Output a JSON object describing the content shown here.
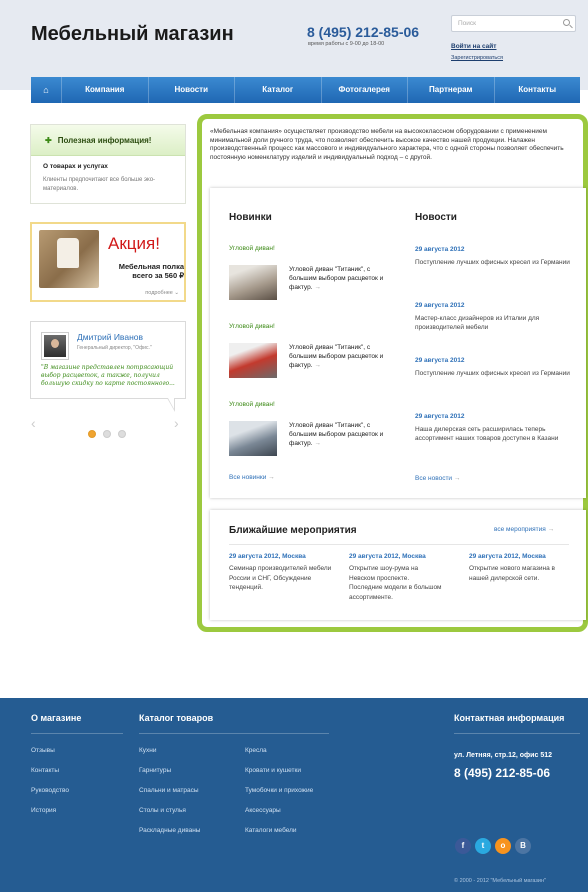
{
  "header": {
    "logo": "Мебельный магазин",
    "phone": "8 (495) 212-85-06",
    "hours": "время работы с 9-00 до 18-00",
    "search_placeholder": "Поиск",
    "login": "Войти на сайт",
    "register": "Зарегистрироваться"
  },
  "nav": {
    "home_icon": "home-icon",
    "items": [
      "Компания",
      "Новости",
      "Каталог",
      "Фотогалерея",
      "Партнерам",
      "Контакты"
    ]
  },
  "sidebar": {
    "useful": {
      "title": "Полезная информация!",
      "link": "О товарах и услугах",
      "text": "Клиенты предпочитают все больше эко-материалов."
    },
    "promo": {
      "badge": "Акция!",
      "text": "Мебельная полка всего за 560 ₽",
      "more": "подробнее"
    },
    "testimonial": {
      "name": "Дмитрий Иванов",
      "role": "Генеральный директор, \"Офис.\"",
      "quote": "\"В магазине представлен потрясающий выбор расцветок, а также, получил большую скидку по карте постоянного..."
    }
  },
  "main": {
    "intro": "«Мебельная компания» осуществляет производство мебели на высококлассном оборудовании с применением минимальной доли ручного труда, что позволяет обеспечить высокое качество нашей продукции. Налажен производственный процесс как массового и индивидуального характера, что с одной стороны позволяет обеспечить постоянную номенклатуру изделий и индивидуальный подход – с другой.",
    "new_title": "Новинки",
    "products": [
      {
        "category": "Угловой диван!",
        "text": "Угловой диван \"Титаник\", с большим выбором расцветок и фактур."
      },
      {
        "category": "Угловой диван!",
        "text": "Угловой диван \"Титаник\", с большим выбором расцветок и фактур."
      },
      {
        "category": "Угловой диван!",
        "text": "Угловой диван \"Титаник\", с большим выбором расцветок и фактур."
      }
    ],
    "all_new": "Все новинки",
    "news_title": "Новости",
    "news": [
      {
        "date": "29 августа 2012",
        "text": "Поступление лучших офисных кресел из Германии"
      },
      {
        "date": "29 августа 2012",
        "text": "Мастер-класс дизайнеров из Италии для производителей мебели"
      },
      {
        "date": "29 августа 2012",
        "text": "Поступление лучших офисных кресел из Германии"
      },
      {
        "date": "29 августа 2012",
        "text": "Наша дилерская сеть расширилась теперь ассортимент наших товаров доступен в Казани"
      }
    ],
    "all_news": "Все новости",
    "events_title": "Ближайшие мероприятия",
    "all_events": "все мероприятия",
    "events": [
      {
        "date": "29 августа 2012, Москва",
        "text": "Семинар производителей мебели России и СНГ, Обсуждение тенденций."
      },
      {
        "date": "29 августа 2012, Москва",
        "text": "Открытие шоу-рума на Невском проспекте. Последние модели в большом ассортименте."
      },
      {
        "date": "29 августа 2012, Москва",
        "text": "Открытие нового магазина в нашей дилерской сети."
      }
    ]
  },
  "footer": {
    "about_title": "О магазине",
    "about_links": [
      "Отзывы",
      "Контакты",
      "Руководство",
      "История"
    ],
    "catalog_title": "Каталог товаров",
    "catalog_col1": [
      "Кухни",
      "Гарнитуры",
      "Спальни и матрасы",
      "Столы и стулья",
      "Раскладные диваны"
    ],
    "catalog_col2": [
      "Кресла",
      "Кровати и кушетки",
      "Тумобочки и прихожие",
      "Аксессуары",
      "Каталоги мебели"
    ],
    "contact_title": "Контактная информация",
    "address": "ул. Летняя, стр.12, офис 512",
    "phone": "8 (495) 212-85-06",
    "socials": [
      {
        "name": "facebook-icon",
        "glyph": "f",
        "color": "#3b5998"
      },
      {
        "name": "twitter-icon",
        "glyph": "t",
        "color": "#2aa9e0"
      },
      {
        "name": "odnoklassniki-icon",
        "glyph": "o",
        "color": "#f7931e"
      },
      {
        "name": "vk-icon",
        "glyph": "B",
        "color": "#4c75a3"
      }
    ],
    "copyright": "© 2000 - 2012 \"Мебельный магазин\""
  }
}
